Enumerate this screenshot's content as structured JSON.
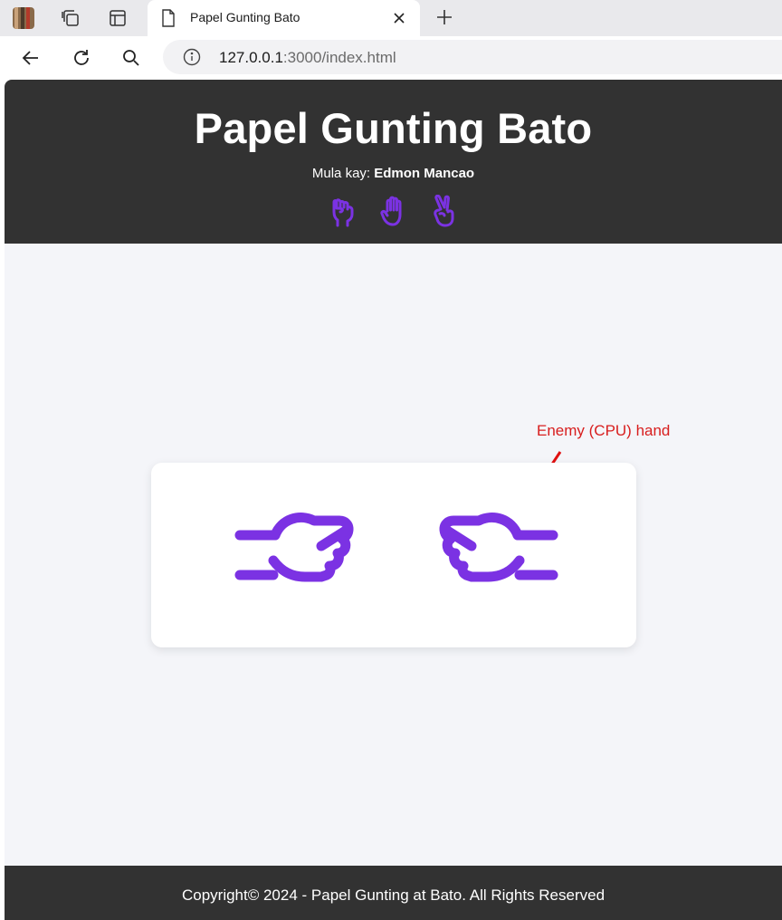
{
  "browser": {
    "tab_title": "Papel Gunting Bato",
    "url_host": "127.0.0.1",
    "url_path": ":3000/index.html"
  },
  "header": {
    "title": "Papel Gunting Bato",
    "byline_prefix": "Mula kay: ",
    "author": "Edmon Mancao",
    "icons": [
      "hand-rock-icon",
      "hand-paper-icon",
      "hand-scissors-icon"
    ]
  },
  "game": {
    "annotation": "Enemy (CPU) hand",
    "player_hand": "hand-rock-icon",
    "cpu_hand": "hand-rock-icon"
  },
  "footer": {
    "copyright": "Copyright© 2024 - Papel Gunting at Bato. All Rights Reserved"
  },
  "colors": {
    "accent": "#7b32e3",
    "header_bg": "#323232",
    "page_bg": "#f4f5f9",
    "annotation": "#d81e1e"
  }
}
